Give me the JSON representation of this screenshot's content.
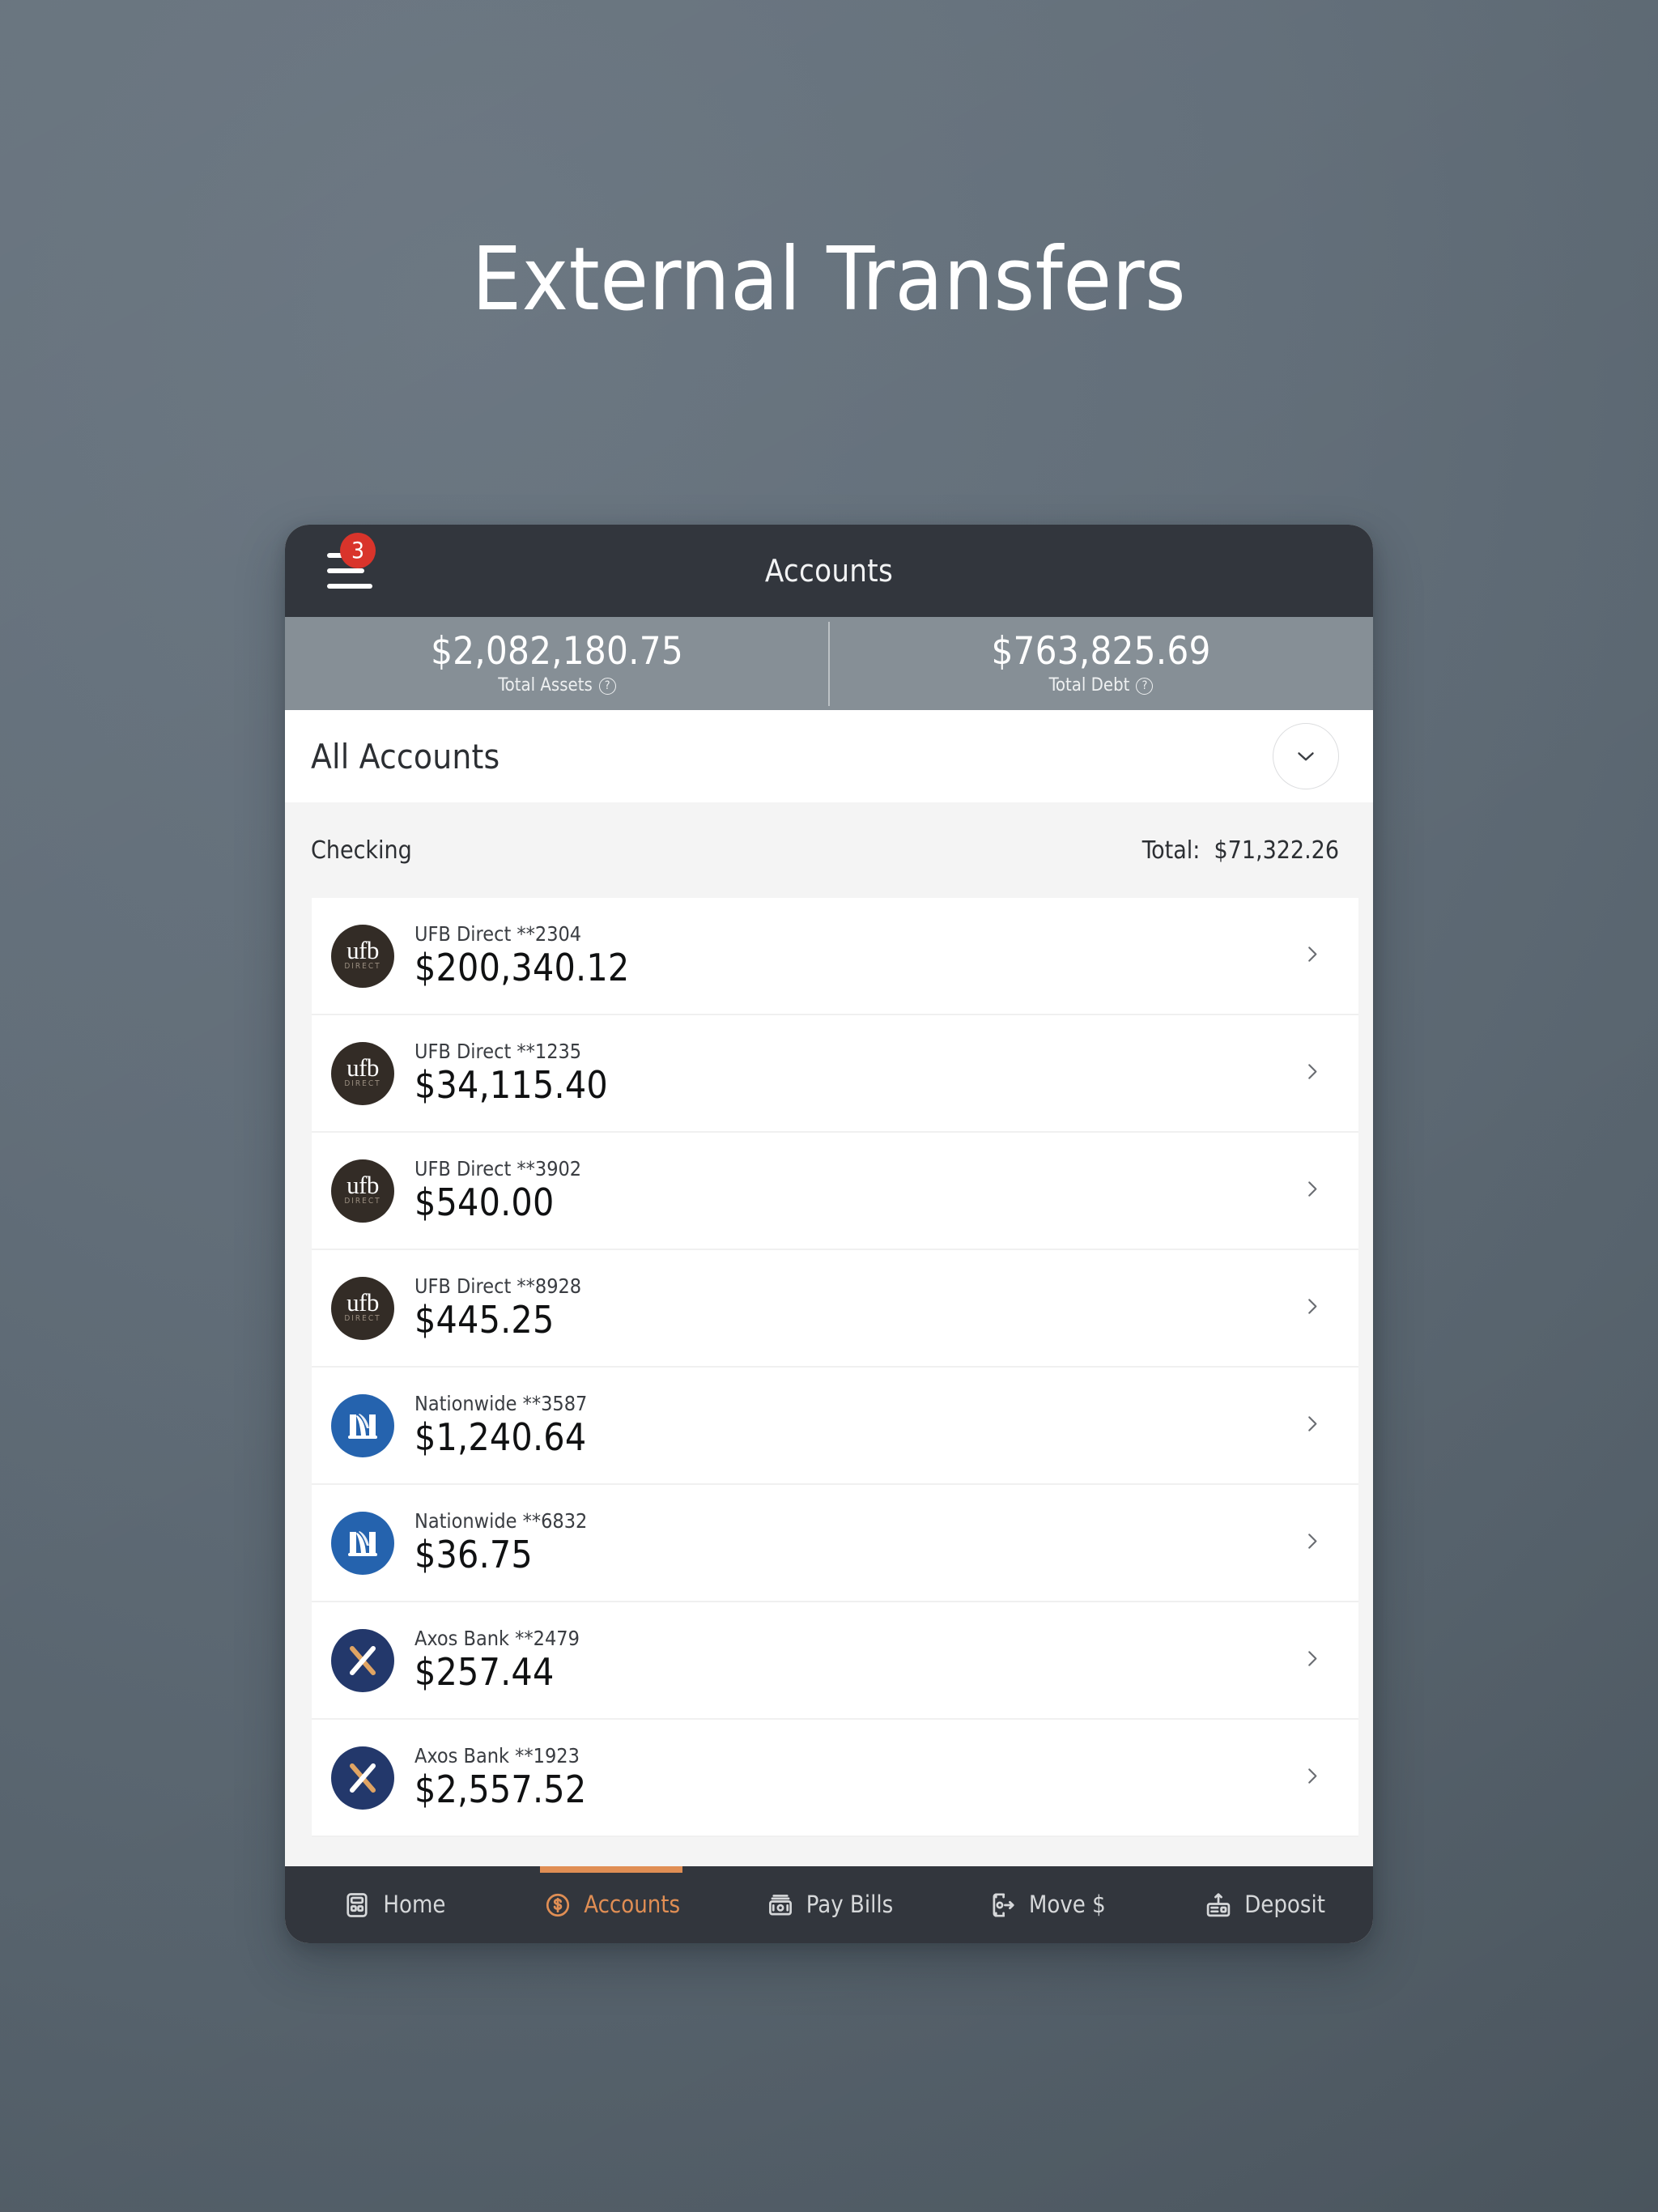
{
  "page": {
    "title": "External Transfers",
    "background_color": "#5f6b76"
  },
  "app": {
    "appbar": {
      "title": "Accounts",
      "menu_badge": "3",
      "background_color": "#32363d"
    },
    "summary": {
      "items": [
        {
          "amount": "$2,082,180.75",
          "label": "Total Assets"
        },
        {
          "amount": "$763,825.69",
          "label": "Total Debt"
        }
      ],
      "background_color": "#868f96"
    },
    "section": {
      "title": "All Accounts"
    },
    "group": {
      "name": "Checking",
      "total_label": "Total:",
      "total_value": "$71,322.26"
    },
    "accounts": [
      {
        "logo": "ufb",
        "name": "UFB Direct **2304",
        "amount": "$200,340.12"
      },
      {
        "logo": "ufb",
        "name": "UFB Direct **1235",
        "amount": "$34,115.40"
      },
      {
        "logo": "ufb",
        "name": "UFB Direct **3902",
        "amount": "$540.00"
      },
      {
        "logo": "ufb",
        "name": "UFB Direct **8928",
        "amount": "$445.25"
      },
      {
        "logo": "nationwide",
        "name": "Nationwide **3587",
        "amount": "$1,240.64"
      },
      {
        "logo": "nationwide",
        "name": "Nationwide **6832",
        "amount": "$36.75"
      },
      {
        "logo": "axos",
        "name": "Axos Bank **2479",
        "amount": "$257.44"
      },
      {
        "logo": "axos",
        "name": "Axos Bank **1923",
        "amount": "$2,557.52"
      }
    ],
    "logo_text": {
      "ufb_primary": "ufb",
      "ufb_secondary": "DIRECT"
    },
    "tabs": [
      {
        "label": "Home",
        "icon": "home-icon",
        "active": false
      },
      {
        "label": "Accounts",
        "icon": "coin-icon",
        "active": true
      },
      {
        "label": "Pay Bills",
        "icon": "banknote-icon",
        "active": false
      },
      {
        "label": "Move $",
        "icon": "transfer-icon",
        "active": false
      },
      {
        "label": "Deposit",
        "icon": "deposit-icon",
        "active": false
      }
    ],
    "accent_color": "#e08e54",
    "badge_color": "#d9342b"
  }
}
